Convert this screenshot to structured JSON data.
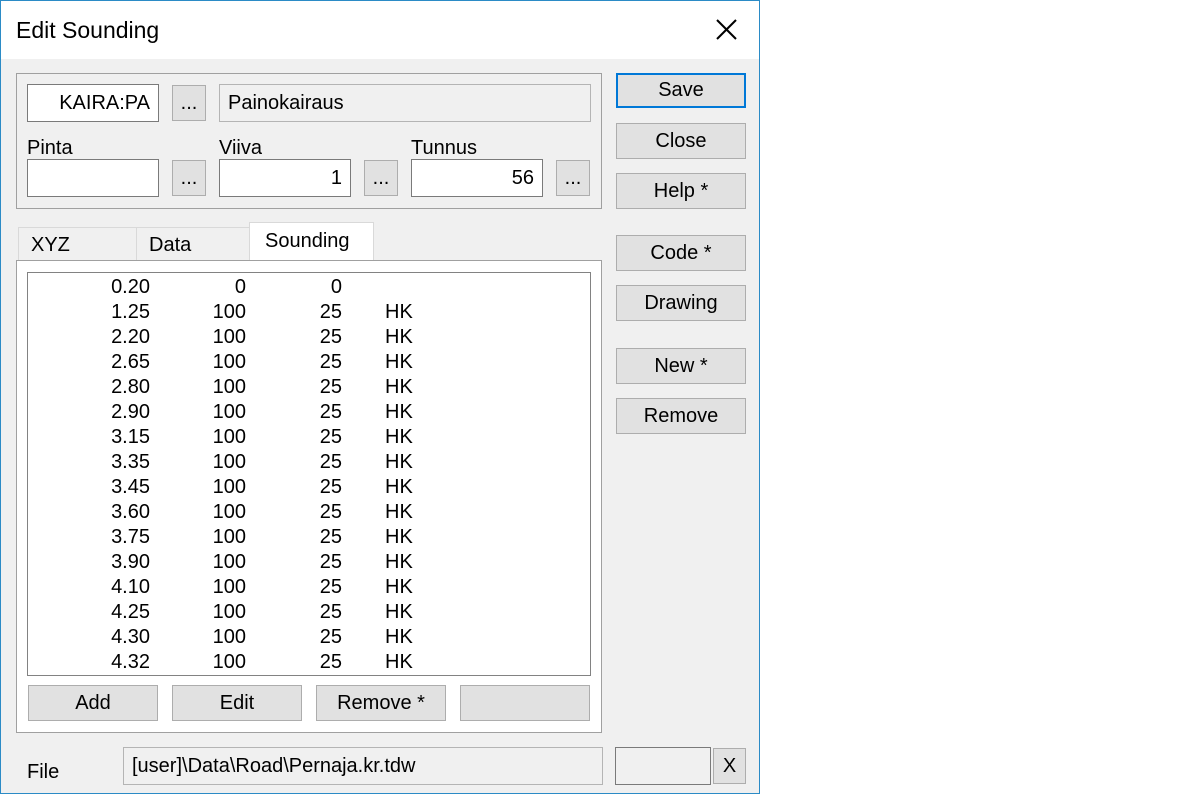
{
  "title": "Edit Sounding",
  "top": {
    "code": "KAIRA:PA",
    "code_browse": "...",
    "description": "Painokairaus",
    "pinta_label": "Pinta",
    "pinta_value": "",
    "pinta_browse": "...",
    "viiva_label": "Viiva",
    "viiva_value": "1",
    "viiva_browse": "...",
    "tunnus_label": "Tunnus",
    "tunnus_value": "56",
    "tunnus_browse": "..."
  },
  "tabs": [
    "XYZ",
    "Data",
    "Sounding"
  ],
  "active_tab": "Sounding",
  "rows": [
    [
      "0.20",
      "0",
      "0",
      ""
    ],
    [
      "1.25",
      "100",
      "25",
      "HK"
    ],
    [
      "2.20",
      "100",
      "25",
      "HK"
    ],
    [
      "2.65",
      "100",
      "25",
      "HK"
    ],
    [
      "2.80",
      "100",
      "25",
      "HK"
    ],
    [
      "2.90",
      "100",
      "25",
      "HK"
    ],
    [
      "3.15",
      "100",
      "25",
      "HK"
    ],
    [
      "3.35",
      "100",
      "25",
      "HK"
    ],
    [
      "3.45",
      "100",
      "25",
      "HK"
    ],
    [
      "3.60",
      "100",
      "25",
      "HK"
    ],
    [
      "3.75",
      "100",
      "25",
      "HK"
    ],
    [
      "3.90",
      "100",
      "25",
      "HK"
    ],
    [
      "4.10",
      "100",
      "25",
      "HK"
    ],
    [
      "4.25",
      "100",
      "25",
      "HK"
    ],
    [
      "4.30",
      "100",
      "25",
      "HK"
    ],
    [
      "4.32",
      "100",
      "25",
      "HK"
    ]
  ],
  "list_buttons": {
    "add": "Add",
    "edit": "Edit",
    "remove": "Remove *",
    "blank": ""
  },
  "side_buttons": {
    "save": "Save",
    "close": "Close",
    "help": "Help *",
    "code": "Code *",
    "drawing": "Drawing",
    "new": "New *",
    "remove": "Remove"
  },
  "file": {
    "label": "File",
    "path": "[user]\\Data\\Road\\Pernaja.kr.tdw",
    "extra": "",
    "clear": "X"
  },
  "colors": {
    "accent": "#0078d7",
    "border": "#2b8bc6",
    "face": "#f0f0f0"
  }
}
